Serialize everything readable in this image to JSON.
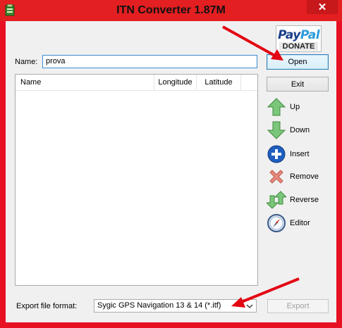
{
  "window": {
    "title": "ITN Converter 1.87M",
    "close_symbol": "✕",
    "accent": "#e31f22"
  },
  "donate": {
    "brand_a": "Pay",
    "brand_b": "Pal",
    "label": "DONATE"
  },
  "name_field": {
    "label": "Name:",
    "value": "prova"
  },
  "list": {
    "columns": [
      "Name",
      "Longitude",
      "Latitude"
    ],
    "rows": []
  },
  "buttons": {
    "open": "Open",
    "exit": "Exit",
    "export": "Export"
  },
  "side": {
    "up": "Up",
    "down": "Down",
    "insert": "Insert",
    "remove": "Remove",
    "reverse": "Reverse",
    "editor": "Editor"
  },
  "format": {
    "label": "Export file format:",
    "selected": "Sygic GPS Navigation 13 & 14 (*.itf)"
  }
}
